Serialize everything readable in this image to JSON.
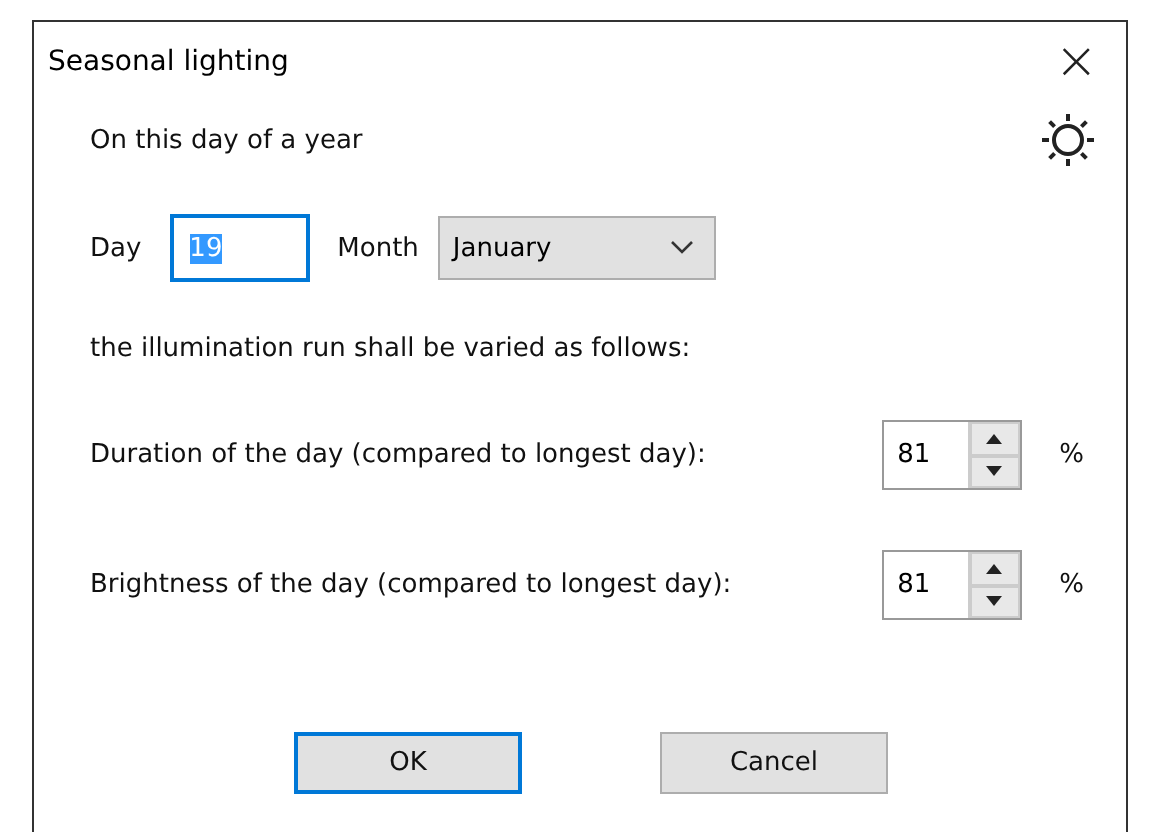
{
  "window": {
    "title": "Seasonal lighting",
    "close": "×"
  },
  "intro": "On this day of a year",
  "day": {
    "label": "Day",
    "value": "19",
    "focused": true,
    "value_selected": true
  },
  "month": {
    "label": "Month",
    "value": "January"
  },
  "subtitle": "the illumination run shall be varied as follows:",
  "spinners": [
    {
      "label": "Duration of the day (compared to longest day):",
      "value": "81",
      "unit": "%"
    },
    {
      "label": "Brightness of the day (compared to longest day):",
      "value": "81",
      "unit": "%"
    }
  ],
  "buttons": [
    {
      "label": "OK",
      "default": true
    },
    {
      "label": "Cancel",
      "default": false
    }
  ]
}
